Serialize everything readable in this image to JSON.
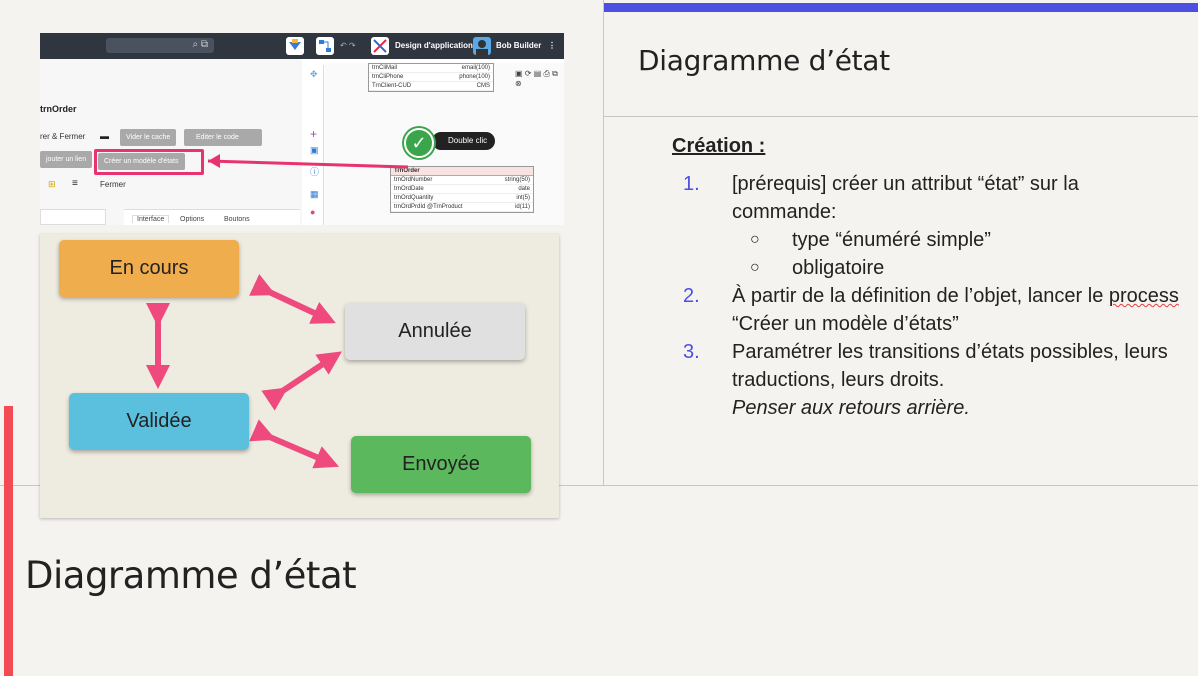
{
  "slide": {
    "title_right": "Diagramme d’état",
    "title_bottom": "Diagramme d’état",
    "colors": {
      "accent_top": "#4d4fe0",
      "accent_left": "#f24b53",
      "background": "#f4f3f0"
    }
  },
  "content": {
    "heading": "Création :",
    "items": [
      {
        "num": "1.",
        "text": "[prérequis] créer un attribut “état” sur la commande:",
        "subitems": [
          {
            "bullet": "○",
            "text": "type “énuméré simple”"
          },
          {
            "bullet": "○",
            "text": "obligatoire"
          }
        ]
      },
      {
        "num": "2.",
        "text_before": "À partir de la définition de l’objet, lancer le ",
        "text_squiggle": "process",
        "text_after": " “Créer un modèle d’états”"
      },
      {
        "num": "3.",
        "text": "Paramétrer les transitions d’états possibles, leurs traductions, leurs droits.",
        "text_italic": "Penser aux retours arrière."
      }
    ]
  },
  "screenshot": {
    "app_title": "Design d'application",
    "user_name": "Bob Builder",
    "object_name": "trnOrder",
    "row_text": "rer & Fermer",
    "btn_clear_cache": "Vider le cache",
    "btn_edit_code": "Editer le code",
    "btn_add_link": "jouter un lien",
    "btn_create_state_model": "Créer un modèle d'états",
    "close_label": "Fermer",
    "tabs": [
      "Interface",
      "Options",
      "Boutons"
    ],
    "double_click": "Double clic",
    "entity_top_rows": [
      {
        "name": "trnCliMail",
        "type": "email(100)"
      },
      {
        "name": "trnCliPhone",
        "type": "phone(100)"
      },
      {
        "name": "TrnClient-CUD",
        "type": "CMS"
      }
    ],
    "entity_main": {
      "header": "TrnOrder",
      "rows": [
        {
          "name": "trnOrdNumber",
          "type": "string(50)"
        },
        {
          "name": "trnOrdDate",
          "type": "date"
        },
        {
          "name": "trnOrdQuantity",
          "type": "int(5)"
        },
        {
          "name": "trnOrdPrdId @TrnProduct",
          "type": "id(11)"
        }
      ]
    }
  },
  "states": {
    "en_cours": {
      "label": "En cours",
      "color": "#f0ad4e"
    },
    "annulee": {
      "label": "Annulée",
      "color": "#e0e0e0"
    },
    "validee": {
      "label": "Validée",
      "color": "#5bc0de"
    },
    "envoyee": {
      "label": "Envoyée",
      "color": "#5cb85c"
    },
    "arrow_color": "#ee4a7d"
  }
}
